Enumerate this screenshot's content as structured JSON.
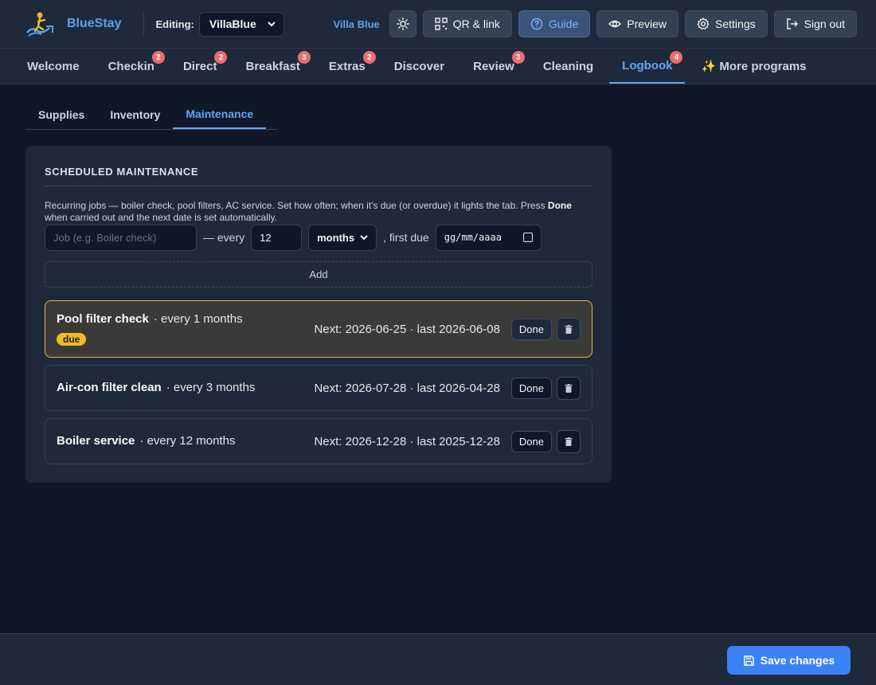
{
  "app": {
    "name": "BlueStay"
  },
  "header": {
    "editing_label": "Editing:",
    "property_selected": "VillaBlue",
    "villa_name": "Villa Blue",
    "buttons": {
      "qr": "QR & link",
      "guide": "Guide",
      "preview": "Preview",
      "settings": "Settings",
      "signout": "Sign out"
    }
  },
  "nav": {
    "tabs": [
      {
        "label": "Welcome",
        "badge": ""
      },
      {
        "label": "Checkin",
        "badge": "2"
      },
      {
        "label": "Direct",
        "badge": "2"
      },
      {
        "label": "Breakfast",
        "badge": "3"
      },
      {
        "label": "Extras",
        "badge": "2"
      },
      {
        "label": "Discover",
        "badge": ""
      },
      {
        "label": "Review",
        "badge": "3"
      },
      {
        "label": "Cleaning",
        "badge": ""
      },
      {
        "label": "Logbook",
        "badge": "4"
      },
      {
        "label": "✨ More programs",
        "badge": ""
      }
    ],
    "active": "Logbook"
  },
  "subtabs": {
    "items": [
      "Supplies",
      "Inventory",
      "Maintenance"
    ],
    "active": "Maintenance"
  },
  "maintenance": {
    "title": "SCHEDULED MAINTENANCE",
    "desc_part1": "Recurring jobs — boiler check, pool filters, AC service. Set how often; when it's due (or overdue) it lights the tab. Press ",
    "desc_bold": "Done",
    "desc_part2": " when carried out and the next date is set automatically.",
    "form": {
      "job_placeholder": "Job (e.g. Boiler check)",
      "every_text": "— every",
      "interval_value": "12",
      "unit_selected": "months",
      "first_due_text": ", first due",
      "date_placeholder": "gg/mm/aaaa"
    },
    "add_label": "Add",
    "done_label": "Done",
    "jobs": [
      {
        "name": "Pool filter check",
        "freq": "· every 1 months",
        "next": "Next: 2026-06-25 · last 2026-06-08",
        "due": true,
        "due_label": "due"
      },
      {
        "name": "Air-con filter clean",
        "freq": "· every 3 months",
        "next": "Next: 2026-07-28 · last 2026-04-28",
        "due": false
      },
      {
        "name": "Boiler service",
        "freq": "· every 12 months",
        "next": "Next: 2026-12-28 · last 2025-12-28",
        "due": false
      }
    ]
  },
  "footer": {
    "save_label": "Save changes"
  },
  "colors": {
    "accent": "#3b82f6",
    "active_tab": "#60a5fa",
    "badge": "#ef6b6b",
    "due": "#f2b928"
  }
}
